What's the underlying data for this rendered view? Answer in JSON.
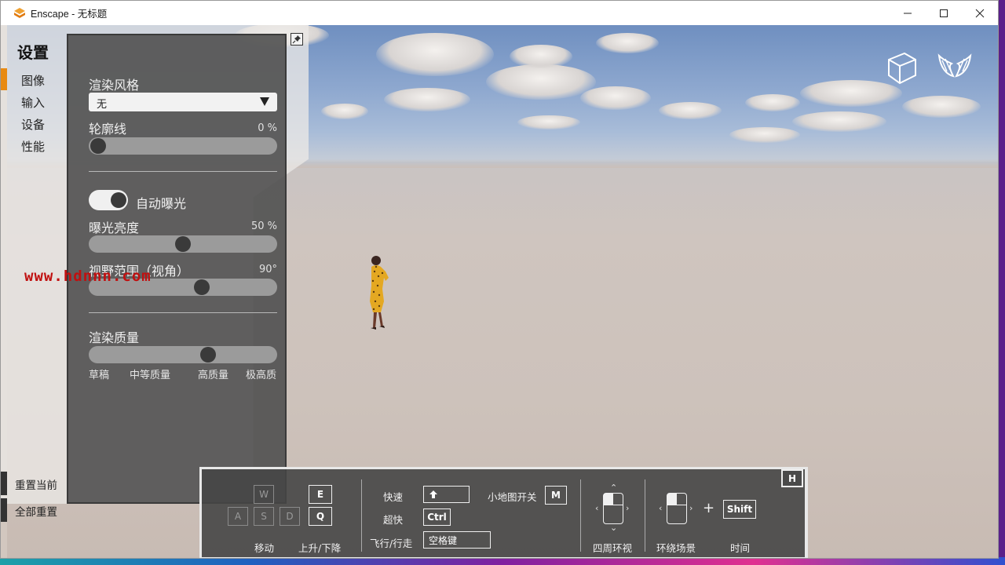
{
  "window": {
    "title": "Enscape - 无标题"
  },
  "settings": {
    "title": "设置",
    "nav": [
      {
        "label": "图像",
        "active": true
      },
      {
        "label": "输入",
        "active": false
      },
      {
        "label": "设备",
        "active": false
      },
      {
        "label": "性能",
        "active": false
      }
    ],
    "reset_current": "重置当前",
    "reset_all": "全部重置",
    "accent_color": "#e88a12"
  },
  "panel": {
    "render_style_label": "渲染风格",
    "render_style_value": "无",
    "outline_label": "轮廓线",
    "outline_value": "0 %",
    "outline_fraction": 0.0,
    "auto_exposure_label": "自动曝光",
    "auto_exposure_on": true,
    "exposure_label": "曝光亮度",
    "exposure_value": "50 %",
    "exposure_fraction": 0.5,
    "fov_label": "视野范围（视角）",
    "fov_value": "90°",
    "fov_fraction": 0.61,
    "quality_label": "渲染质量",
    "quality_fraction": 0.65,
    "quality_levels": [
      "草稿",
      "中等质量",
      "高质量",
      "极高质"
    ]
  },
  "watermark": "www.hdnnn.com",
  "help": {
    "toggle_key": "H",
    "keys_wasd": [
      "W",
      "A",
      "S",
      "D"
    ],
    "key_e": "E",
    "key_q": "Q",
    "move_label": "移动",
    "updown_label": "上升/下降",
    "fast_label": "快速",
    "superfast_label": "超快",
    "flywalk_label": "飞行/行走",
    "key_ctrl": "Ctrl",
    "key_space": "空格键",
    "minimap_label": "小地图开关",
    "key_m": "M",
    "look_around_label": "四周环视",
    "orbit_label": "环绕场景",
    "time_label": "时间",
    "key_shift": "Shift",
    "plus": "+"
  }
}
